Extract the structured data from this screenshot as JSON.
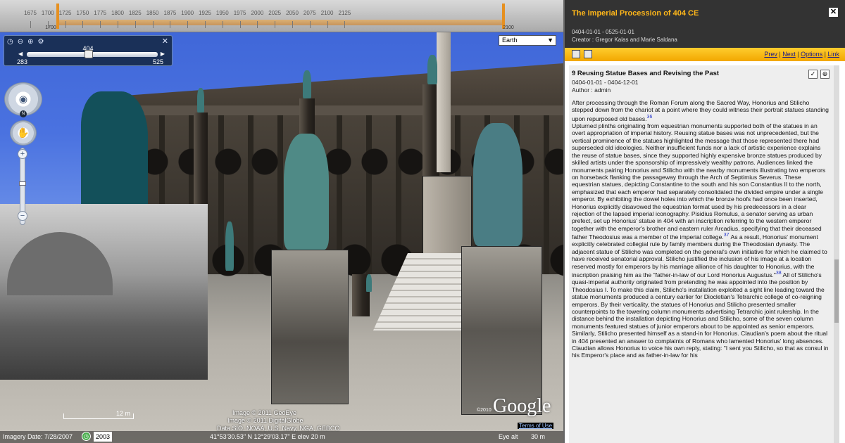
{
  "timeline": {
    "ticks": [
      "1675",
      "1700",
      "1725",
      "1750",
      "1775",
      "1800",
      "1825",
      "1850",
      "1875",
      "1900",
      "1925",
      "1950",
      "1975",
      "2000",
      "2025",
      "2050",
      "2075",
      "2100",
      "2125"
    ],
    "range_start_label": "1700",
    "range_end_label": "2100"
  },
  "historical_control": {
    "current_year": "404",
    "min": "283",
    "max": "525",
    "position": 0.5
  },
  "layer_select": {
    "value": "Earth"
  },
  "map": {
    "scale_label": "12 m",
    "credit_line1": "Image © 2011 GeoEye",
    "credit_line2": "Image © 2011 DigitalGlobe",
    "credit_line3": "Data SIO, NOAA, U.S. Navy, NGA, GEBCO",
    "google_logo": "Google",
    "copyright_year": "©2010",
    "terms": "Terms of Use"
  },
  "status": {
    "imagery_date": "Imagery Date: 7/28/2007",
    "year": "2003",
    "coords": "41°53'30.53\" N   12°29'03.17\" E   elev   20 m",
    "eye_alt_label": "Eye alt",
    "eye_alt_value": "30 m"
  },
  "panel": {
    "title": "The Imperial Procession of 404 CE",
    "dates": "0404-01-01 - 0525-01-01",
    "creator": "Creator : Gregor Kalas and Marie Saldana",
    "links": {
      "prev": "Prev",
      "next": "Next",
      "options": "Options",
      "link": "Link"
    },
    "entry": {
      "title": "9 Reusing Statue Bases and Revising the Past",
      "dates": "0404-01-01 - 0404-12-01",
      "author": "Author : admin",
      "body_p1": "After processing through the Roman Forum along the Sacred Way, Honorius and Stilicho stepped down from the chariot at a point where they could witness their portrait statues standing upon repurposed old bases.",
      "fn1": "36",
      "body_p2": "Upturned plinths originating from equestrian monuments supported both of the statues in an overt appropriation of imperial history.  Reusing statue bases was not unprecedented, but the vertical prominence of the statues highlighted the message that those represented there had superseded old ideologies.  Neither insufficient funds nor a lack of artistic experience explains the reuse of statue bases, since they supported highly expensive bronze statues produced by skilled artists under the sponsorship of impressively wealthy patrons.  Audiences linked the monuments pairing Honorius and Stilicho with the nearby monuments illustrating two emperors on horseback flanking the passageway through the Arch of Septimius Severus.  These equestrian statues, depicting Constantine to the south and his son Constantius II to the north, emphasized that each emperor had separately consolidated the divided empire under a single emperor.  By exhibiting the dowel holes into which the bronze hoofs had once been inserted, Honorius explicitly disavowed the equestrian format used by his predecessors in a clear rejection of the lapsed imperial iconography.  Pisidius Romulus, a senator serving as urban prefect, set up Honorius' statue in 404 with an inscription referring to the western emperor together with the emperor's brother and eastern ruler Arcadius, specifying that their deceased father Theodosius was a member of the imperial college.",
      "fn2": "37",
      "body_p3": "  As a result, Honorius' monument explicitly celebrated collegial rule by family members during the Theodosian dynasty.  The adjacent statue of Stilicho was completed on the general's own initiative for which he claimed to have received senatorial approval.  Stilicho justified the inclusion of his image at a location reserved mostly for emperors by his marriage alliance of his daughter to Honorius, with the inscription praising him as the \"father-in-law of our Lord Honorius Augustus.\"",
      "fn3": "38",
      "body_p4": "  All of Stilicho's quasi-imperial authority originated from pretending he was appointed into the position by Theodosius I.  To make this claim, Stilicho's installation exploited a sight line leading toward the statue monuments produced a century earlier for Diocletian's Tetrarchic college of co-reigning emperors.  By their verticality, the statues of Honorius and Stilicho presented smaller counterpoints to the towering column monuments advertising Tetrarchic joint rulership.  In the distance behind the installation depicting Honorius and Stilicho, some of the seven column monuments featured statues of junior emperors about to be appointed as senior emperors.  Similarly, Stilicho presented himself as a stand-in for Honorius.  Claudian's poem about the ritual in 404 presented an answer to complaints of Romans who lamented Honorius' long absences.  Claudian allows Honorius to voice his own reply, stating: \"I sent you Stilicho, so that as consul in his Emperor's place and as father-in-law for his"
    }
  },
  "colors": {
    "panel_title": "#ffb71a",
    "toolbar": "#f2a700",
    "timeline_range": "#e69020"
  }
}
